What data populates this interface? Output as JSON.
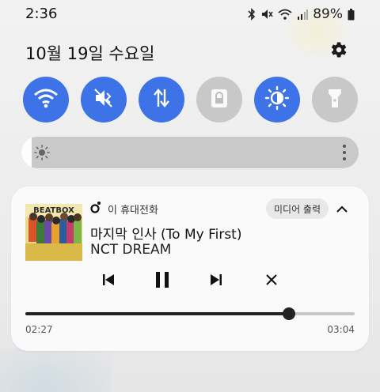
{
  "status_bar": {
    "time": "2:36",
    "battery": "89%",
    "icons": [
      "bluetooth-icon",
      "mute-icon",
      "wifi-icon",
      "signal-icon",
      "battery-icon"
    ]
  },
  "panel": {
    "date": "10월 19일 수요일"
  },
  "quick_toggles": [
    {
      "name": "wifi",
      "icon": "wifi-icon",
      "state": "on"
    },
    {
      "name": "sound",
      "icon": "mute-icon",
      "state": "on"
    },
    {
      "name": "mobile-data",
      "icon": "data-transfer-icon",
      "state": "on"
    },
    {
      "name": "lock",
      "icon": "lock-icon",
      "state": "off"
    },
    {
      "name": "auto-brightness",
      "icon": "sun-icon",
      "state": "on"
    },
    {
      "name": "flashlight",
      "icon": "flashlight-icon",
      "state": "off"
    }
  ],
  "brightness": {
    "level": 0.03
  },
  "media": {
    "app_name": "이 휴대전화",
    "output_label": "미디어 출력",
    "title": "마지막 인사 (To My First)",
    "artist": "NCT DREAM",
    "elapsed": "02:27",
    "total": "03:04",
    "progress": 0.8,
    "album_art_text": "BEATBOX"
  },
  "colors": {
    "accent": "#3e73e8",
    "toggle_off": "#c8c8c8"
  }
}
